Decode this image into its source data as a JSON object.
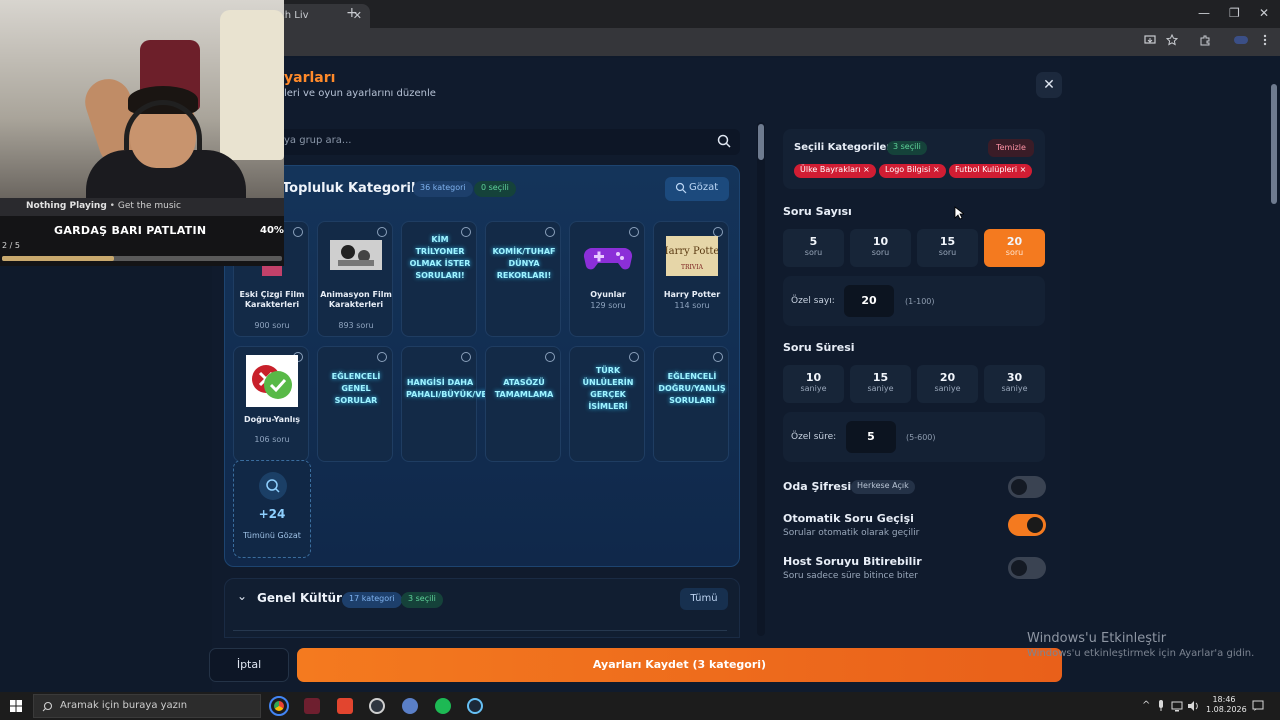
{
  "browser": {
    "tab_title": "Watch Liv",
    "new_tab": "+",
    "minimize": "—",
    "restore": "❐",
    "close": "✕"
  },
  "modal": {
    "title": "yarları",
    "subtitle": "leri ve oyun ayarlarını düzenle",
    "close_symbol": "✕"
  },
  "search": {
    "placeholder": "ya grup ara..."
  },
  "community": {
    "title": "Topluluk Kategorileri",
    "count_badge": "36 kategori",
    "selected_badge": "0 seçili",
    "browse_label": "Gözat",
    "cards": [
      {
        "name": "Eski Çizgi Film Karakterleri",
        "count": "900 soru",
        "kind": "image"
      },
      {
        "name": "Animasyon Film Karakterleri",
        "count": "893 soru",
        "kind": "image"
      },
      {
        "name": "KİM TRİLYONER OLMAK İSTER SORULARI!",
        "count": "",
        "kind": "neon"
      },
      {
        "name": "KOMİK/TUHAF DÜNYA REKORLARI!",
        "count": "",
        "kind": "neon"
      },
      {
        "name": "Oyunlar",
        "count": "129 soru",
        "kind": "image"
      },
      {
        "name": "Harry Potter",
        "count": "114 soru",
        "kind": "image"
      },
      {
        "name": "Doğru-Yanlış",
        "count": "106 soru",
        "kind": "image"
      },
      {
        "name": "EĞLENCELİ GENEL SORULAR",
        "count": "",
        "kind": "neon"
      },
      {
        "name": "HANGİSİ DAHA PAHALI/BÜYÜK/VB",
        "count": "",
        "kind": "neon"
      },
      {
        "name": "ATASÖZÜ TAMAMLAMA",
        "count": "",
        "kind": "neon"
      },
      {
        "name": "TÜRK ÜNLÜLERİN GERÇEK İSİMLERİ",
        "count": "",
        "kind": "neon"
      },
      {
        "name": "EĞLENCELİ DOĞRU/YANLIŞ SORULARI",
        "count": "",
        "kind": "neon"
      }
    ],
    "harry_potter_logo": "Harry Potter",
    "trivia_text": "TRIVIA",
    "more_count": "+24",
    "more_label": "Tümünü Gözat"
  },
  "genel": {
    "title": "Genel Kültür",
    "count_badge": "17 kategori",
    "selected_badge": "3 seçili",
    "all_label": "Tümü",
    "chevron": "⌄"
  },
  "selected": {
    "title": "Seçili Kategoriler",
    "count_badge": "3 seçili",
    "clear_label": "Temizle",
    "chips": [
      "Ülke Bayrakları ×",
      "Logo Bilgisi ×",
      "Futbol Kulüpleri ×"
    ]
  },
  "question_count": {
    "label": "Soru Sayısı",
    "options": [
      {
        "value": "5",
        "unit": "soru"
      },
      {
        "value": "10",
        "unit": "soru"
      },
      {
        "value": "15",
        "unit": "soru"
      },
      {
        "value": "20",
        "unit": "soru"
      }
    ],
    "active_value": "20",
    "custom_label": "Özel sayı:",
    "custom_value": "20",
    "custom_range": "(1-100)"
  },
  "question_time": {
    "label": "Soru Süresi",
    "options": [
      {
        "value": "10",
        "unit": "saniye"
      },
      {
        "value": "15",
        "unit": "saniye"
      },
      {
        "value": "20",
        "unit": "saniye"
      },
      {
        "value": "30",
        "unit": "saniye"
      }
    ],
    "custom_label": "Özel süre:",
    "custom_value": "5",
    "custom_range": "(5-600)"
  },
  "toggles": {
    "room_password": {
      "label": "Oda Şifresi",
      "badge": "Herkese Açık",
      "on": false
    },
    "auto_next": {
      "label": "Otomatik Soru Geçişi",
      "desc": "Sorular otomatik olarak geçilir",
      "on": true
    },
    "host_finish": {
      "label": "Host Soruyu Bitirebilir",
      "desc": "Soru sadece süre bitince biter",
      "on": false
    }
  },
  "actions": {
    "cancel_label": "İptal",
    "save_label": "Ayarları Kaydet (3 kategori)"
  },
  "windows_watermark": {
    "line1": "Windows'u Etkinleştir",
    "line2": "Windows'u etkinleştirmek için Ayarlar'a gidin."
  },
  "now_playing": {
    "label": "Nothing Playing",
    "separator": "•",
    "sub": "Get the music",
    "song_title": "GARDAŞ BARI PATLATIN",
    "percent": "40%",
    "progress": 0.4,
    "index": "2 / 5"
  },
  "taskbar": {
    "search_placeholder": "Aramak için buraya yazın",
    "time": "18:46",
    "date": "1.08.2026",
    "tray_caret": "^"
  },
  "colors": {
    "accent": "#f47a1f",
    "danger": "#d11d33",
    "bg": "#0f1a2b"
  }
}
